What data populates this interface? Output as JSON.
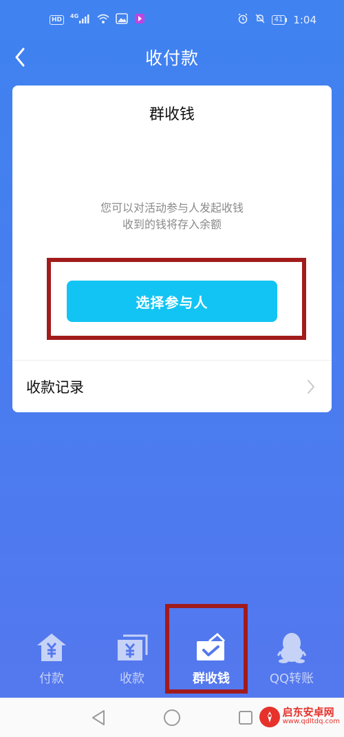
{
  "status_bar": {
    "hd": "HD",
    "network": "4G",
    "battery": "41",
    "time": "1:04"
  },
  "header": {
    "title": "收付款"
  },
  "card": {
    "title": "群收钱",
    "desc_line1": "您可以对活动参与人发起收钱",
    "desc_line2": "收到的钱将存入余额",
    "button_label": "选择参与人",
    "record_label": "收款记录"
  },
  "tabs": [
    {
      "label": "付款",
      "icon": "pay-icon",
      "active": false
    },
    {
      "label": "收款",
      "icon": "receive-icon",
      "active": false
    },
    {
      "label": "群收钱",
      "icon": "group-collect-icon",
      "active": true
    },
    {
      "label": "QQ转账",
      "icon": "qq-penguin-icon",
      "active": false
    }
  ],
  "watermark": {
    "name": "启东安卓网",
    "url": "www.qdltdq.com"
  },
  "colors": {
    "background": "#4a7cf0",
    "primary_button": "#12c4f3",
    "highlight": "#a21b1b",
    "watermark": "#e6322b"
  }
}
